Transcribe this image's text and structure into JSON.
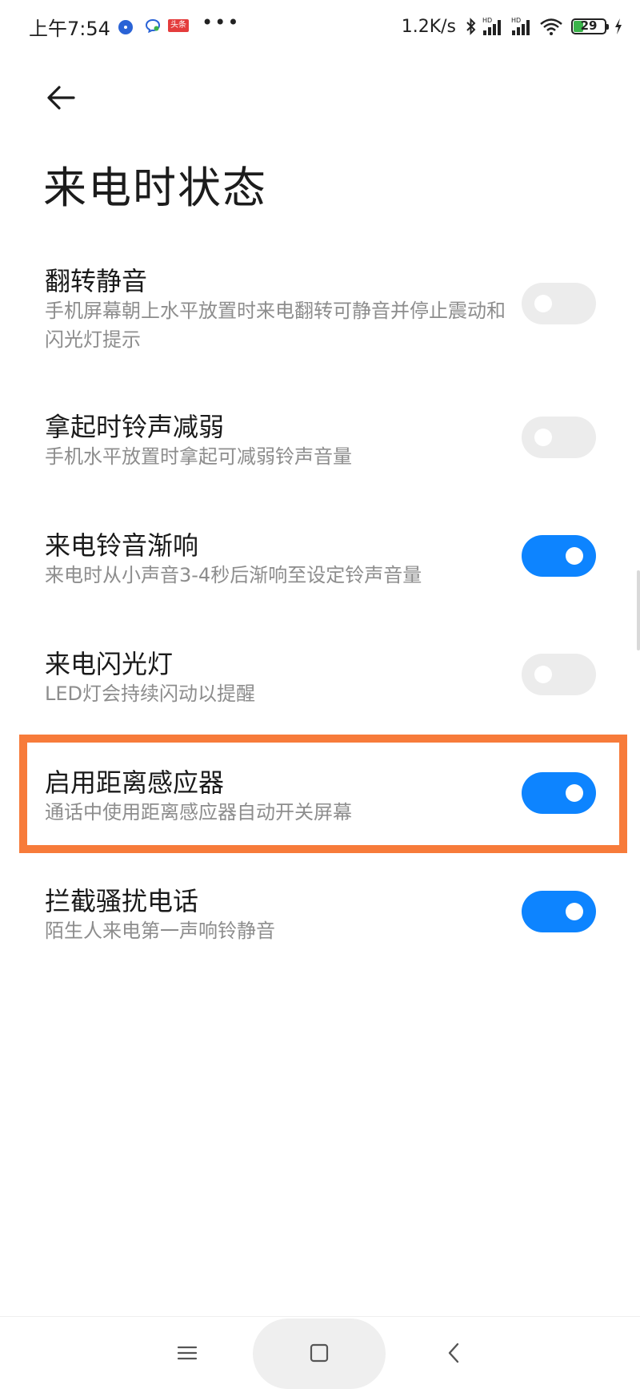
{
  "status_bar": {
    "time": "上午7:54",
    "notification_badge": "头条",
    "more": "•••",
    "network_speed": "1.2K/s",
    "signal_label_1": "HD",
    "signal_label_2": "HD",
    "battery_level": "29",
    "icons": [
      "browser-icon",
      "chat-icon",
      "toutiao-icon",
      "more-icon",
      "bluetooth-icon",
      "signal-hd-icon",
      "signal-hd-icon",
      "wifi-icon",
      "battery-icon",
      "charging-icon"
    ]
  },
  "header": {
    "back_icon": "arrow-left-icon",
    "title": "来电时状态"
  },
  "settings": [
    {
      "title": "翻转静音",
      "desc": "手机屏幕朝上水平放置时来电翻转可静音并停止震动和闪光灯提示",
      "enabled": false
    },
    {
      "title": "拿起时铃声减弱",
      "desc": "手机水平放置时拿起可减弱铃声音量",
      "enabled": false
    },
    {
      "title": "来电铃音渐响",
      "desc": "来电时从小声音3-4秒后渐响至设定铃声音量",
      "enabled": true
    },
    {
      "title": "来电闪光灯",
      "desc": "LED灯会持续闪动以提醒",
      "enabled": false
    },
    {
      "title": "启用距离感应器",
      "desc": "通话中使用距离感应器自动开关屏幕",
      "enabled": true,
      "highlighted": true
    },
    {
      "title": "拦截骚扰电话",
      "desc": "陌生人来电第一声响铃静音",
      "enabled": true
    }
  ],
  "colors": {
    "toggle_on": "#0d84ff",
    "toggle_off": "#ececec",
    "highlight": "#f77b3a",
    "desc_text": "#8d8d8d"
  },
  "nav_bar": {
    "icons": [
      "menu-icon",
      "home-icon",
      "back-icon"
    ]
  }
}
